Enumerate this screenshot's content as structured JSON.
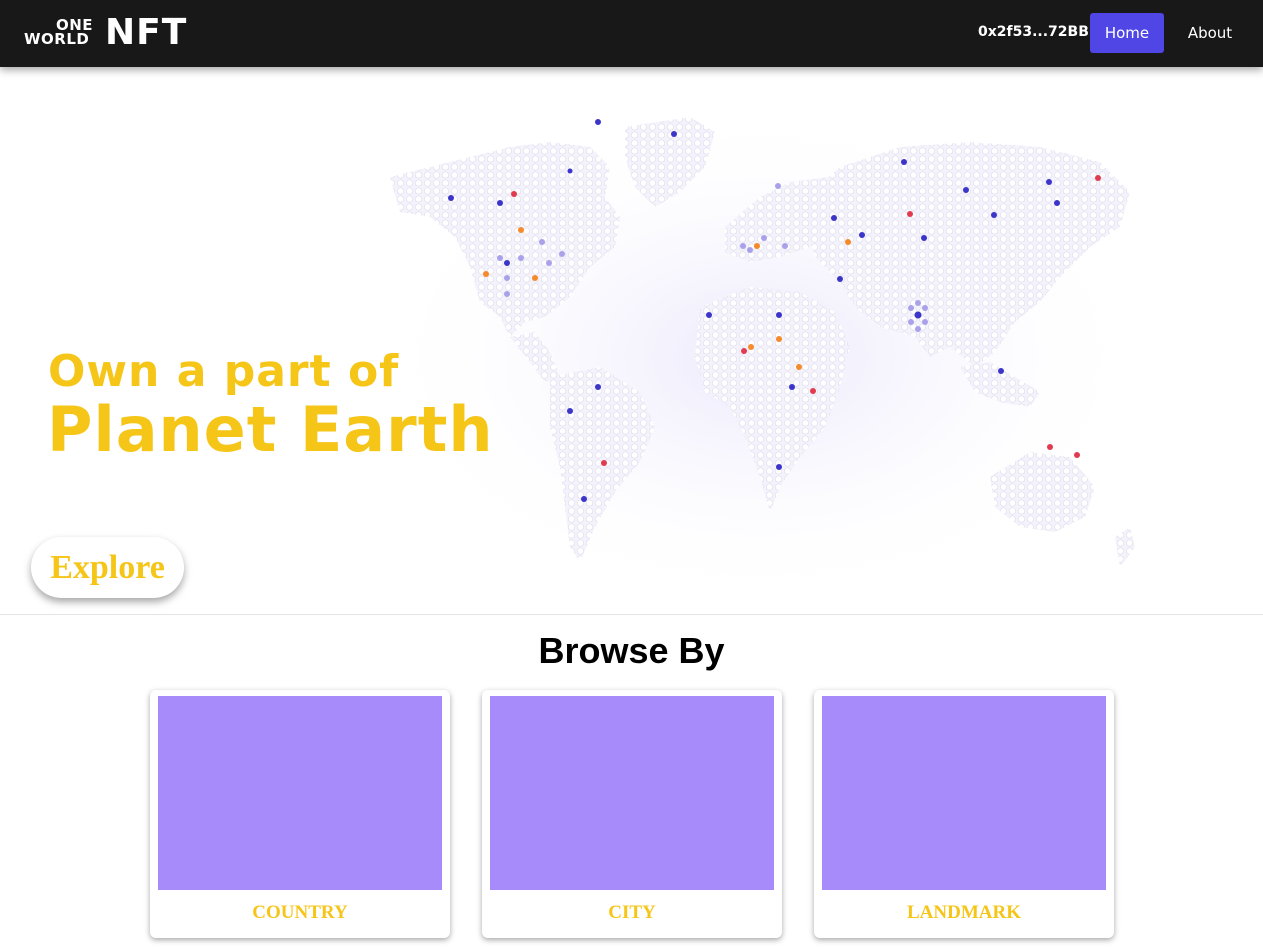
{
  "navbar": {
    "logo": {
      "small_top": "ONE",
      "small_bottom": "WORLD",
      "big": "NFT"
    },
    "wallet_address": "0x2f53...72BB",
    "links": [
      {
        "label": "Home",
        "active": true
      },
      {
        "label": "About",
        "active": false
      }
    ]
  },
  "hero": {
    "headline_line1": "Own a part of",
    "headline_line2": "Planet Earth",
    "cta_label": "Explore",
    "map_icon": "world-map-icon",
    "marker_colors": {
      "blue": "#3b35c9",
      "red": "#e23b4f",
      "orange": "#f58a2a",
      "lavender": "#a9a1ea"
    }
  },
  "browse": {
    "title": "Browse By",
    "cards": [
      {
        "label": "COUNTRY"
      },
      {
        "label": "CITY"
      },
      {
        "label": "LANDMARK"
      }
    ]
  },
  "colors": {
    "nav_bg": "#181818",
    "accent": "#4f46e5",
    "yellow": "#f5c518",
    "card_placeholder": "#a78bfa"
  }
}
